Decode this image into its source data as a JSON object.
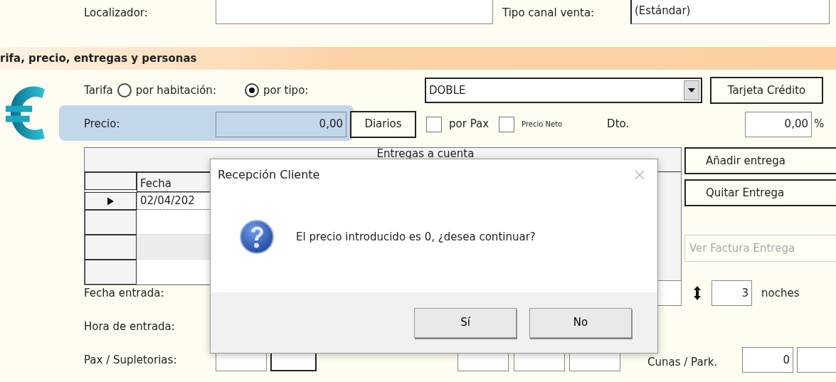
{
  "top_row": {
    "localizador_label": "Localizador:",
    "canal_label": "Tipo canal venta:",
    "canal_value": "(Estándar)"
  },
  "section_title": "rifa, precio, entregas y personas",
  "tarifa": {
    "label": "Tarifa",
    "options": [
      {
        "label": "por habitación:",
        "selected": false
      },
      {
        "label": "por tipo:",
        "selected": true
      }
    ],
    "tipo_value": "DOBLE",
    "card_button": "Tarjeta Crédito"
  },
  "precio": {
    "label": "Precio:",
    "value": "0,00",
    "diarios_button": "Diarios",
    "checks": [
      {
        "label": "por Pax",
        "checked": false
      },
      {
        "label": "Precio Neto",
        "checked": false
      }
    ],
    "dto_label": "Dto.",
    "dto_value": "0,00",
    "percent": "%"
  },
  "entregas": {
    "title": "Entregas a cuenta",
    "column": "Fecha",
    "rows": [
      {
        "current": true,
        "fecha": "02/04/202"
      },
      {
        "current": false
      },
      {
        "current": false
      },
      {
        "current": false
      }
    ]
  },
  "entrega_buttons": [
    {
      "label": "Añadir entrega",
      "disabled": false
    },
    {
      "label": "Quitar Entrega",
      "disabled": false
    },
    {
      "label": "Ver Factura Entrega",
      "disabled": true
    }
  ],
  "fecha_entrada": {
    "label": "Fecha entrada:",
    "nights": "3",
    "nights_label": "noches"
  },
  "hora_entrada": {
    "label": "Hora de entrada:"
  },
  "pax": {
    "label": "Pax / Supletorias:",
    "cunas_label": "Cunas / Park.",
    "cunas_value": "0"
  },
  "dialog": {
    "title": "Recepción Cliente",
    "message": "El precio introducido es 0, ¿desea continuar?",
    "buttons": [
      "Sí",
      "No"
    ]
  }
}
